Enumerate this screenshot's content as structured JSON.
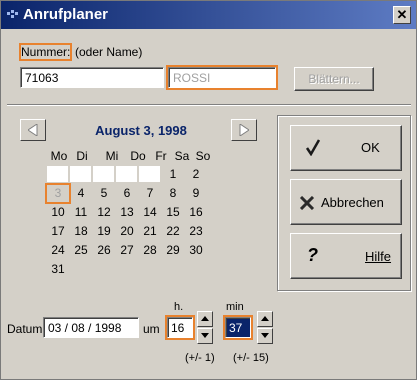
{
  "window": {
    "title": "Anrufplaner",
    "close_label": "✕"
  },
  "nummer": {
    "label_main": "Nummer:",
    "label_rest": "(oder Name)",
    "number_value": "71063",
    "name_value": "ROSSI",
    "browse_label": "Blättern..."
  },
  "calendar": {
    "month_title": "August 3, 1998",
    "weekdays": [
      "Mo",
      "Di",
      "Mi",
      "Do",
      "Fr",
      "Sa",
      "So"
    ],
    "days": [
      "1",
      "2",
      "3",
      "4",
      "5",
      "6",
      "7",
      "8",
      "9",
      "10",
      "11",
      "12",
      "13",
      "14",
      "15",
      "16",
      "17",
      "18",
      "19",
      "20",
      "21",
      "22",
      "23",
      "24",
      "25",
      "26",
      "27",
      "28",
      "29",
      "30",
      "31"
    ],
    "selected_day": "3"
  },
  "datum": {
    "label": "Datum",
    "value": "03 / 08 / 1998",
    "um_label": "um",
    "hour_label": "h.",
    "hour_value": "16",
    "minute_label": "min",
    "minute_value": "37",
    "hour_step": "(+/- 1)",
    "minute_step": "(+/- 15)"
  },
  "actions": {
    "ok_label": "OK",
    "cancel_label": "Abbrechen",
    "help_label": "Hilfe"
  }
}
